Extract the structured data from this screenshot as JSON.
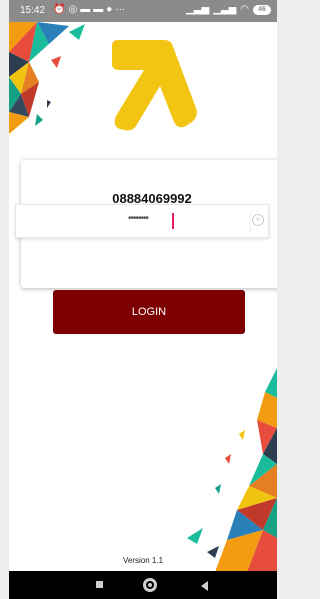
{
  "status_bar": {
    "time": "15:42",
    "left_icons": [
      "alarm-icon",
      "shield-icon",
      "message-icon",
      "message-icon",
      "facebook-icon",
      "more-icon"
    ],
    "more": "···",
    "battery": "46"
  },
  "login": {
    "phone_number": "08884069992",
    "password_mask": "••••••••",
    "button_label": "LOGIN"
  },
  "footer": {
    "version": "Version 1.1"
  },
  "colors": {
    "logo_yellow": "#f2c512",
    "button": "#7d0000",
    "cursor": "#e91e63",
    "status_bar": "#8b8b8b"
  }
}
